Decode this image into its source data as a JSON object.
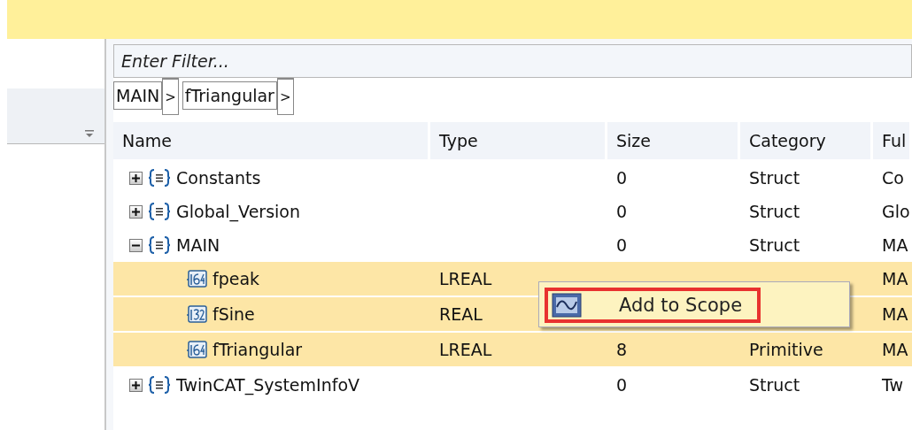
{
  "filter": {
    "placeholder": "Enter Filter..."
  },
  "breadcrumb": [
    {
      "label": "MAIN",
      "separator": ">"
    },
    {
      "label": "fTriangular",
      "separator": ">"
    }
  ],
  "table": {
    "columns": [
      "Name",
      "Type",
      "Size",
      "Category",
      "Ful"
    ],
    "rows": [
      {
        "name": "Constants",
        "kind": "struct",
        "expanded": false,
        "selected": false,
        "type": "",
        "size": "0",
        "category": "Struct",
        "full": "Co"
      },
      {
        "name": "Global_Version",
        "kind": "struct",
        "expanded": false,
        "selected": false,
        "type": "",
        "size": "0",
        "category": "Struct",
        "full": "Glo"
      },
      {
        "name": "MAIN",
        "kind": "struct",
        "expanded": true,
        "selected": false,
        "type": "",
        "size": "0",
        "category": "Struct",
        "full": "MA",
        "children": [
          {
            "name": "fpeak",
            "kind": "f64",
            "selected": true,
            "type": "LREAL",
            "full": "MA"
          },
          {
            "name": "fSine",
            "kind": "f32",
            "selected": true,
            "type": "REAL",
            "full": "MA"
          },
          {
            "name": "fTriangular",
            "kind": "f64",
            "selected": true,
            "type": "LREAL",
            "size": "8",
            "category": "Primitive",
            "full": "MA"
          }
        ]
      },
      {
        "name": "TwinCAT_SystemInfoV",
        "kind": "struct",
        "expanded": false,
        "selected": false,
        "type": "",
        "size": "0",
        "category": "Struct",
        "full": "Tw"
      }
    ]
  },
  "context_menu": {
    "items": [
      {
        "label": "Add to Scope",
        "selected": true
      }
    ]
  }
}
